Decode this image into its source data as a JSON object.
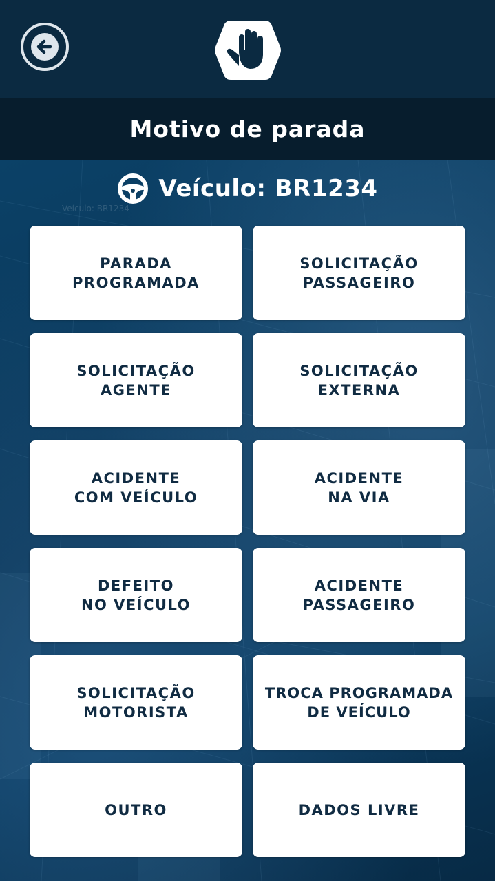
{
  "header": {
    "back_icon": "arrow-left-icon",
    "logo_icon": "stop-hand-icon",
    "colors": {
      "header_bg": "#0b2a41",
      "title_bar_bg": "#071d2d",
      "button_text": "#102b42"
    }
  },
  "title": "Motivo de parada",
  "vehicle": {
    "icon": "steering-wheel-icon",
    "label": "Veículo: BR1234",
    "watermark": "Veículo: BR1234"
  },
  "reasons": [
    {
      "label": "PARADA\nPROGRAMADA"
    },
    {
      "label": "SOLICITAÇÃO\nPASSAGEIRO"
    },
    {
      "label": "SOLICITAÇÃO\nAGENTE"
    },
    {
      "label": "SOLICITAÇÃO\nEXTERNA"
    },
    {
      "label": "ACIDENTE\nCOM VEÍCULO"
    },
    {
      "label": "ACIDENTE\nNA VIA"
    },
    {
      "label": "DEFEITO\nNO VEÍCULO"
    },
    {
      "label": "ACIDENTE\nPASSAGEIRO"
    },
    {
      "label": "SOLICITAÇÃO\nMOTORISTA"
    },
    {
      "label": "TROCA PROGRAMADA\nDE VEÍCULO"
    },
    {
      "label": "OUTRO"
    },
    {
      "label": "DADOS LIVRE"
    }
  ]
}
